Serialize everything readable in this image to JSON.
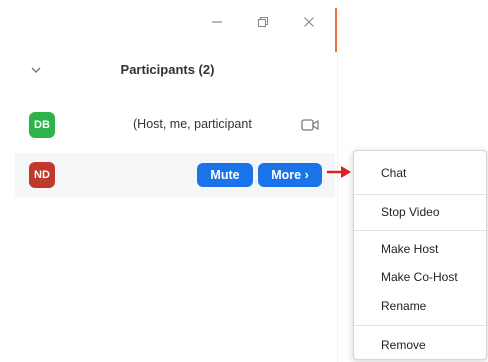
{
  "window": {
    "minimize_icon": "minimize-icon",
    "restore_icon": "restore-icon",
    "close_icon": "close-icon",
    "accent_color": "#e8703a"
  },
  "header": {
    "title": "Participants (2)",
    "collapse_icon": "chevron-down-icon"
  },
  "participants": [
    {
      "initials": "DB",
      "avatar_color": "#2db34a",
      "name": "(Host, me, participant",
      "video_icon": "video-camera-icon"
    },
    {
      "initials": "ND",
      "avatar_color": "#c0392b",
      "mute_label": "Mute",
      "more_label": "More ›",
      "button_color": "#1a73e8"
    }
  ],
  "annotation": {
    "arrow_color": "#e02020"
  },
  "more_menu": {
    "items": [
      {
        "label": "Chat"
      },
      {
        "label": "Stop Video"
      },
      {
        "label": "Make Host"
      },
      {
        "label": "Make Co-Host"
      },
      {
        "label": "Rename"
      },
      {
        "label": "Remove"
      }
    ]
  }
}
